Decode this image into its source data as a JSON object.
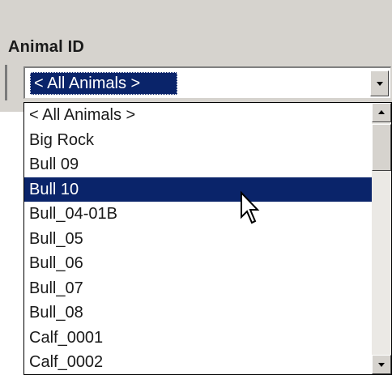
{
  "field": {
    "label": "Animal ID",
    "selected_value": "< All Animals >"
  },
  "dropdown": {
    "items": [
      "< All Animals >",
      "Big Rock",
      "Bull 09",
      "Bull 10",
      "Bull_04-01B",
      "Bull_05",
      "Bull_06",
      "Bull_07",
      "Bull_08",
      "Calf_0001",
      "Calf_0002"
    ],
    "highlighted_item": "Bull 10"
  },
  "icons": {
    "combo_button": "chevron-down-icon",
    "scroll_up": "scroll-up-arrow-icon",
    "scroll_down": "scroll-down-arrow-icon",
    "pointer": "mouse-pointer-icon"
  },
  "colors": {
    "selection": "#0a246a",
    "chrome": "#d6d3ce"
  }
}
